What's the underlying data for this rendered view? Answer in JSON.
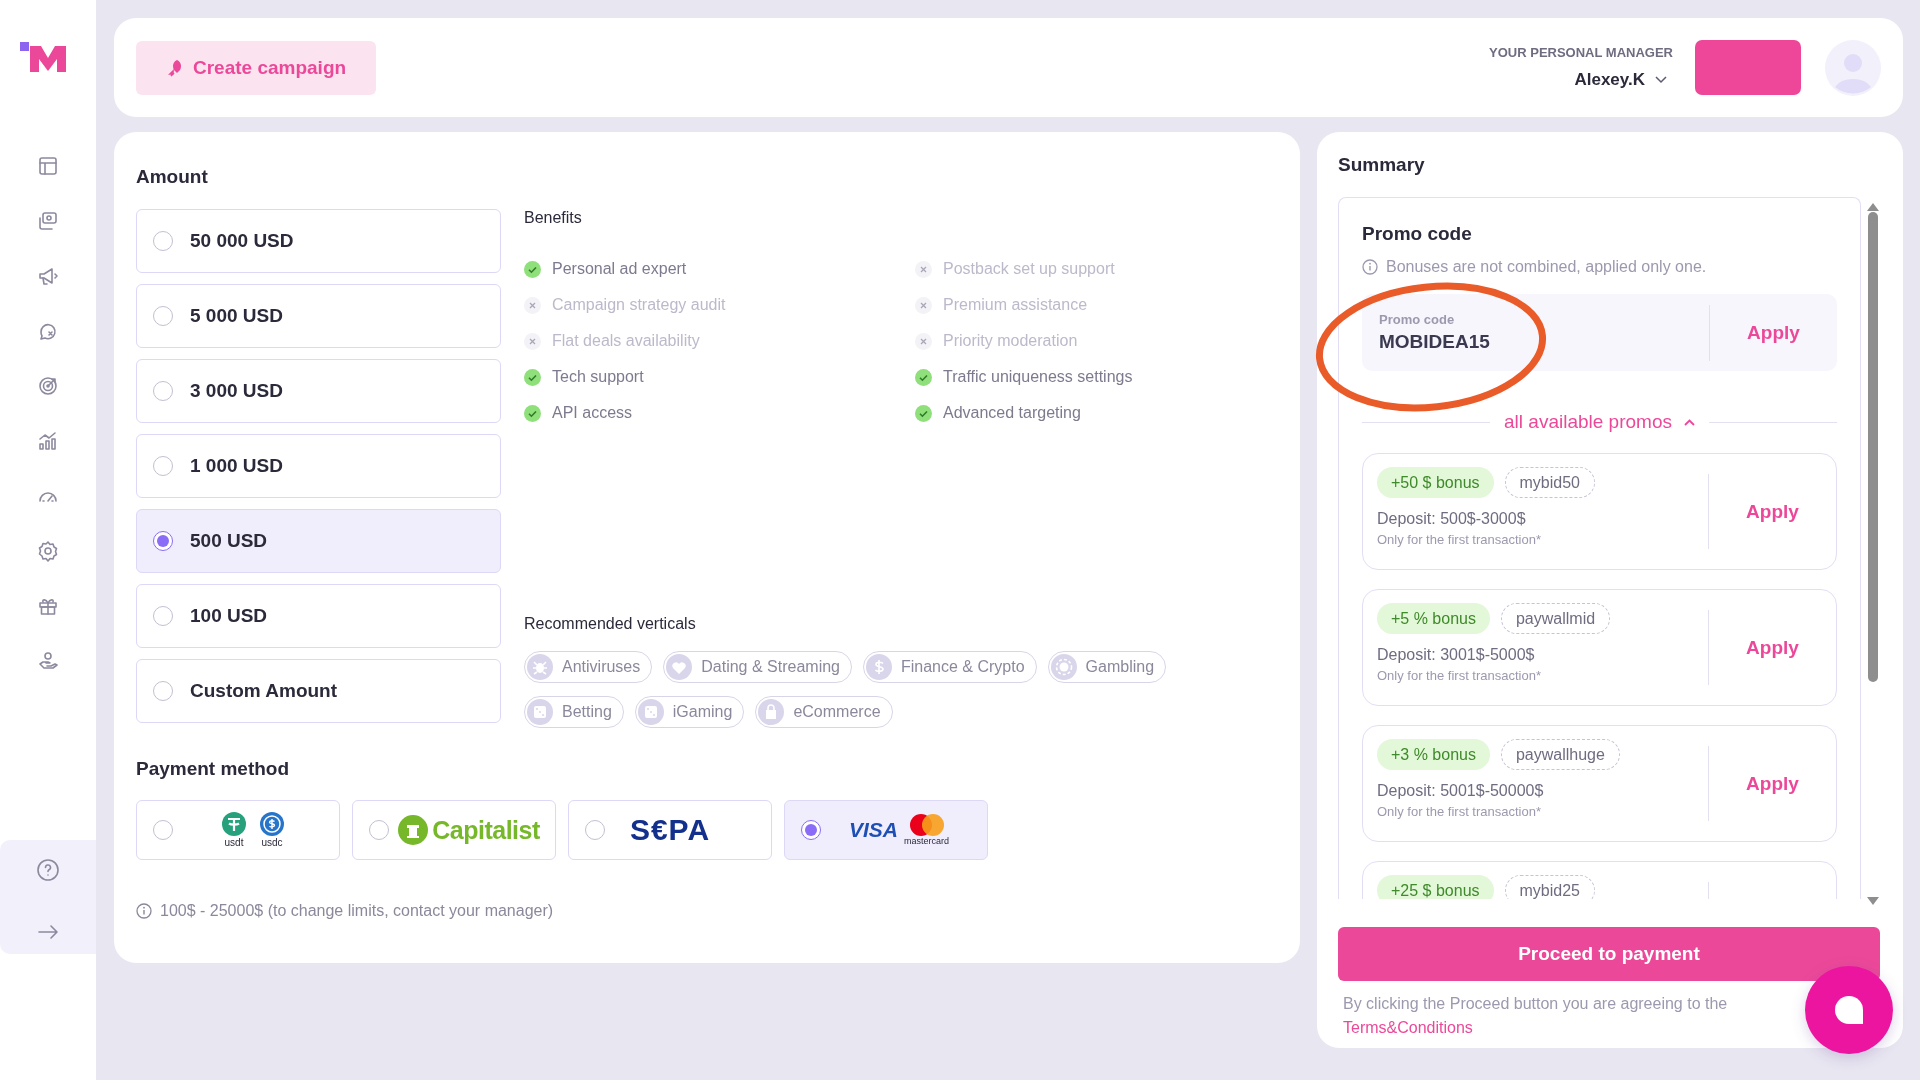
{
  "header": {
    "create_button": "Create campaign",
    "manager_label": "YOUR PERSONAL MANAGER",
    "manager_name": "Alexey.K"
  },
  "amount": {
    "title": "Amount",
    "options": [
      {
        "label": "50 000 USD",
        "selected": false
      },
      {
        "label": "5 000 USD",
        "selected": false
      },
      {
        "label": "3 000 USD",
        "selected": false
      },
      {
        "label": "1 000 USD",
        "selected": false
      },
      {
        "label": "500 USD",
        "selected": true
      },
      {
        "label": "100 USD",
        "selected": false
      },
      {
        "label": "Custom Amount",
        "selected": false
      }
    ]
  },
  "benefits": {
    "title": "Benefits",
    "items": [
      {
        "label": "Personal ad expert",
        "included": true
      },
      {
        "label": "Campaign strategy audit",
        "included": false
      },
      {
        "label": "Flat deals availability",
        "included": false
      },
      {
        "label": "Tech support",
        "included": true
      },
      {
        "label": "API access",
        "included": true
      },
      {
        "label": "Postback set up support",
        "included": false
      },
      {
        "label": "Premium assistance",
        "included": false
      },
      {
        "label": "Priority moderation",
        "included": false
      },
      {
        "label": "Traffic uniqueness settings",
        "included": true
      },
      {
        "label": "Advanced targeting",
        "included": true
      }
    ]
  },
  "verticals": {
    "title": "Recommended verticals",
    "chips": [
      {
        "label": "Antiviruses",
        "kind": "bug"
      },
      {
        "label": "Dating & Streaming",
        "kind": "heart"
      },
      {
        "label": "Finance & Crypto",
        "kind": "dollar"
      },
      {
        "label": "Gambling",
        "kind": "chip"
      },
      {
        "label": "Betting",
        "kind": "dice"
      },
      {
        "label": "iGaming",
        "kind": "dice"
      },
      {
        "label": "eCommerce",
        "kind": "bag"
      }
    ]
  },
  "payment": {
    "title": "Payment method",
    "methods": [
      {
        "kind": "crypto",
        "selected": false,
        "labels": [
          "usdt",
          "usdc"
        ]
      },
      {
        "kind": "capitalist",
        "selected": false,
        "labels": [
          "Capitalist"
        ]
      },
      {
        "kind": "sepa",
        "selected": false,
        "labels": [
          "S€PA"
        ]
      },
      {
        "kind": "card",
        "selected": true,
        "labels": [
          "VISA",
          "mastercard"
        ]
      }
    ],
    "limits": "100$ - 25000$ (to change limits, contact your manager)"
  },
  "summary": {
    "title": "Summary",
    "promo_title": "Promo code",
    "note": "Bonuses are not combined, applied only one.",
    "field_label": "Promo code",
    "field_value": "MOBIDEA15",
    "apply": "Apply",
    "toggle": "all available promos",
    "expanded": true,
    "promos": [
      {
        "bonus": "+50 $ bonus",
        "code": "mybid50",
        "deposit": "Deposit: 500$-3000$",
        "condition": "Only for the first transaction*",
        "apply": "Apply"
      },
      {
        "bonus": "+5 % bonus",
        "code": "paywallmid",
        "deposit": "Deposit: 3001$-5000$",
        "condition": "Only for the first transaction*",
        "apply": "Apply"
      },
      {
        "bonus": "+3 % bonus",
        "code": "paywallhuge",
        "deposit": "Deposit: 5001$-50000$",
        "condition": "Only for the first transaction*",
        "apply": "Apply"
      },
      {
        "bonus": "+25 $ bonus",
        "code": "mybid25"
      }
    ],
    "proceed": "Proceed to payment",
    "terms": "By clicking the Proceed button you are agreeing to the",
    "terms_link": "Terms&Conditions"
  }
}
